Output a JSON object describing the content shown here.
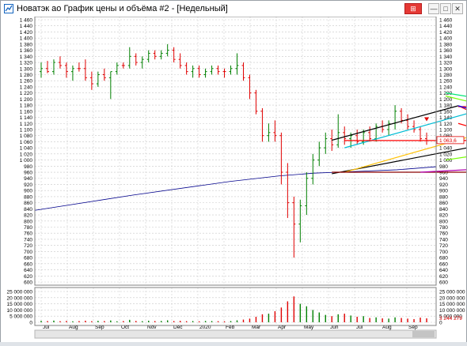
{
  "window": {
    "title": "Новатэк ао График цены и объёма #2 - [Недельный]",
    "buttons": {
      "pin": "⊞",
      "minimize": "—",
      "maximize": "□",
      "close": "✕"
    }
  },
  "chart_data": {
    "type": "ohlc-bar",
    "title": "",
    "price_axis": {
      "ylim": [
        600,
        1460
      ],
      "ticks": [
        "1 460",
        "1 440",
        "1 420",
        "1 400",
        "1 380",
        "1 360",
        "1 340",
        "1 320",
        "1 300",
        "1 280",
        "1 260",
        "1 240",
        "1 220",
        "1 200",
        "1 180",
        "1 160",
        "1 140",
        "1 120",
        "1 100",
        "1 080",
        "1 060",
        "1 040",
        "1 020",
        "1 000",
        "980",
        "960",
        "940",
        "920",
        "900",
        "880",
        "860",
        "840",
        "820",
        "800",
        "780",
        "760",
        "740",
        "720",
        "700",
        "680",
        "660",
        "640",
        "620",
        "600"
      ]
    },
    "volume_axis": {
      "ylim": [
        0,
        25000000
      ],
      "ticks": [
        "25 000 000",
        "20 000 000",
        "15 000 000",
        "10 000 000",
        "5 000 000",
        "0"
      ]
    },
    "x_axis": {
      "labels": [
        "Jul",
        "Aug",
        "Sep",
        "Oct",
        "Nov",
        "Dec",
        "2020",
        "Feb",
        "Mar",
        "Apr",
        "May",
        "Jun",
        "Jul",
        "Aug",
        "Sep"
      ]
    },
    "last_price_label": "1 063,6",
    "last_volume_label": "3 244 279",
    "bars": [
      {
        "o": 1290,
        "h": 1320,
        "l": 1270,
        "c": 1300,
        "up": true
      },
      {
        "o": 1300,
        "h": 1325,
        "l": 1285,
        "c": 1290,
        "up": false
      },
      {
        "o": 1290,
        "h": 1330,
        "l": 1280,
        "c": 1320,
        "up": true
      },
      {
        "o": 1320,
        "h": 1340,
        "l": 1300,
        "c": 1310,
        "up": false
      },
      {
        "o": 1310,
        "h": 1320,
        "l": 1270,
        "c": 1290,
        "up": false
      },
      {
        "o": 1290,
        "h": 1310,
        "l": 1260,
        "c": 1300,
        "up": true
      },
      {
        "o": 1300,
        "h": 1320,
        "l": 1290,
        "c": 1300,
        "up": false
      },
      {
        "o": 1300,
        "h": 1330,
        "l": 1260,
        "c": 1270,
        "up": false
      },
      {
        "o": 1270,
        "h": 1290,
        "l": 1230,
        "c": 1250,
        "up": false
      },
      {
        "o": 1250,
        "h": 1290,
        "l": 1240,
        "c": 1280,
        "up": true
      },
      {
        "o": 1280,
        "h": 1300,
        "l": 1260,
        "c": 1270,
        "up": false
      },
      {
        "o": 1270,
        "h": 1290,
        "l": 1200,
        "c": 1290,
        "up": true
      },
      {
        "o": 1290,
        "h": 1320,
        "l": 1280,
        "c": 1310,
        "up": true
      },
      {
        "o": 1310,
        "h": 1320,
        "l": 1300,
        "c": 1310,
        "up": false
      },
      {
        "o": 1310,
        "h": 1370,
        "l": 1300,
        "c": 1340,
        "up": true
      },
      {
        "o": 1340,
        "h": 1350,
        "l": 1310,
        "c": 1320,
        "up": false
      },
      {
        "o": 1320,
        "h": 1340,
        "l": 1300,
        "c": 1330,
        "up": true
      },
      {
        "o": 1330,
        "h": 1360,
        "l": 1320,
        "c": 1350,
        "up": true
      },
      {
        "o": 1350,
        "h": 1360,
        "l": 1330,
        "c": 1340,
        "up": false
      },
      {
        "o": 1340,
        "h": 1360,
        "l": 1330,
        "c": 1350,
        "up": true
      },
      {
        "o": 1350,
        "h": 1380,
        "l": 1340,
        "c": 1360,
        "up": true
      },
      {
        "o": 1360,
        "h": 1370,
        "l": 1320,
        "c": 1330,
        "up": false
      },
      {
        "o": 1330,
        "h": 1350,
        "l": 1300,
        "c": 1310,
        "up": false
      },
      {
        "o": 1310,
        "h": 1320,
        "l": 1280,
        "c": 1290,
        "up": false
      },
      {
        "o": 1290,
        "h": 1310,
        "l": 1270,
        "c": 1300,
        "up": true
      },
      {
        "o": 1300,
        "h": 1310,
        "l": 1270,
        "c": 1280,
        "up": false
      },
      {
        "o": 1280,
        "h": 1300,
        "l": 1270,
        "c": 1290,
        "up": true
      },
      {
        "o": 1290,
        "h": 1310,
        "l": 1280,
        "c": 1300,
        "up": true
      },
      {
        "o": 1300,
        "h": 1310,
        "l": 1280,
        "c": 1290,
        "up": false
      },
      {
        "o": 1290,
        "h": 1300,
        "l": 1270,
        "c": 1290,
        "up": false
      },
      {
        "o": 1290,
        "h": 1310,
        "l": 1280,
        "c": 1300,
        "up": true
      },
      {
        "o": 1300,
        "h": 1350,
        "l": 1280,
        "c": 1310,
        "up": true
      },
      {
        "o": 1310,
        "h": 1320,
        "l": 1260,
        "c": 1270,
        "up": false
      },
      {
        "o": 1270,
        "h": 1280,
        "l": 1200,
        "c": 1220,
        "up": false
      },
      {
        "o": 1220,
        "h": 1230,
        "l": 1150,
        "c": 1160,
        "up": false
      },
      {
        "o": 1160,
        "h": 1170,
        "l": 1060,
        "c": 1080,
        "up": false
      },
      {
        "o": 1080,
        "h": 1120,
        "l": 1060,
        "c": 1090,
        "up": true
      },
      {
        "o": 1090,
        "h": 1130,
        "l": 1060,
        "c": 1080,
        "up": false
      },
      {
        "o": 1080,
        "h": 1090,
        "l": 920,
        "c": 960,
        "up": false
      },
      {
        "o": 960,
        "h": 990,
        "l": 810,
        "c": 860,
        "up": false
      },
      {
        "o": 860,
        "h": 880,
        "l": 680,
        "c": 790,
        "up": false
      },
      {
        "o": 790,
        "h": 870,
        "l": 730,
        "c": 850,
        "up": true
      },
      {
        "o": 850,
        "h": 960,
        "l": 820,
        "c": 940,
        "up": true
      },
      {
        "o": 940,
        "h": 1020,
        "l": 920,
        "c": 1000,
        "up": true
      },
      {
        "o": 1000,
        "h": 1060,
        "l": 980,
        "c": 1040,
        "up": true
      },
      {
        "o": 1040,
        "h": 1090,
        "l": 1020,
        "c": 1070,
        "up": true
      },
      {
        "o": 1070,
        "h": 1100,
        "l": 1030,
        "c": 1050,
        "up": false
      },
      {
        "o": 1050,
        "h": 1150,
        "l": 1040,
        "c": 1090,
        "up": true
      },
      {
        "o": 1090,
        "h": 1110,
        "l": 1050,
        "c": 1070,
        "up": false
      },
      {
        "o": 1070,
        "h": 1090,
        "l": 1040,
        "c": 1080,
        "up": true
      },
      {
        "o": 1080,
        "h": 1100,
        "l": 1050,
        "c": 1060,
        "up": false
      },
      {
        "o": 1060,
        "h": 1100,
        "l": 1050,
        "c": 1090,
        "up": true
      },
      {
        "o": 1090,
        "h": 1110,
        "l": 1060,
        "c": 1070,
        "up": false
      },
      {
        "o": 1070,
        "h": 1120,
        "l": 1060,
        "c": 1110,
        "up": true
      },
      {
        "o": 1110,
        "h": 1130,
        "l": 1090,
        "c": 1100,
        "up": false
      },
      {
        "o": 1100,
        "h": 1130,
        "l": 1080,
        "c": 1120,
        "up": true
      },
      {
        "o": 1120,
        "h": 1180,
        "l": 1100,
        "c": 1160,
        "up": true
      },
      {
        "o": 1160,
        "h": 1170,
        "l": 1120,
        "c": 1130,
        "up": false
      },
      {
        "o": 1130,
        "h": 1150,
        "l": 1100,
        "c": 1110,
        "up": false
      },
      {
        "o": 1110,
        "h": 1130,
        "l": 1090,
        "c": 1100,
        "up": false
      },
      {
        "o": 1100,
        "h": 1110,
        "l": 1060,
        "c": 1070,
        "up": false
      },
      {
        "o": 1070,
        "h": 1090,
        "l": 1050,
        "c": 1064,
        "up": false
      }
    ],
    "volumes": [
      1.2,
      1.0,
      1.4,
      0.9,
      1.1,
      0.8,
      1.0,
      1.3,
      0.9,
      1.2,
      1.0,
      1.5,
      0.8,
      1.0,
      2.0,
      1.1,
      0.9,
      1.3,
      1.0,
      1.1,
      1.6,
      1.0,
      1.2,
      0.9,
      1.0,
      0.8,
      1.1,
      1.0,
      0.9,
      0.8,
      1.0,
      1.6,
      2.2,
      3.0,
      4.5,
      6.5,
      7.0,
      9.0,
      12.0,
      17.0,
      21.0,
      15.0,
      13.0,
      10.0,
      8.0,
      6.0,
      5.0,
      6.5,
      7.0,
      5.5,
      4.5,
      5.0,
      3.5,
      4.0,
      3.2,
      3.0,
      4.0,
      3.5,
      3.0,
      2.6,
      3.8,
      3.2
    ],
    "ma_line": [
      [
        0,
        835
      ],
      [
        20,
        885
      ],
      [
        40,
        930
      ],
      [
        50,
        948
      ],
      [
        57,
        957
      ],
      [
        62,
        960
      ],
      [
        74,
        968
      ],
      [
        82,
        978
      ]
    ],
    "drawings": [
      {
        "color": "#000000",
        "pts": [
          [
            46,
            1065
          ],
          [
            66,
            1178
          ]
        ]
      },
      {
        "color": "#000000",
        "pts": [
          [
            46,
            955
          ],
          [
            75,
            1070
          ]
        ]
      },
      {
        "color": "#00bcd4",
        "pts": [
          [
            48,
            1040
          ],
          [
            80,
            1225
          ]
        ]
      },
      {
        "color": "#ffc107",
        "pts": [
          [
            48,
            960
          ],
          [
            76,
            1125
          ]
        ]
      },
      {
        "color": "#ff0000",
        "pts": [
          [
            48,
            1064
          ],
          [
            78,
            1064
          ]
        ]
      },
      {
        "color": "#ff0000",
        "pts": [
          [
            66,
            1175
          ],
          [
            78,
            1175
          ]
        ]
      },
      {
        "color": "#ff0000",
        "pts": [
          [
            66,
            1120
          ],
          [
            76,
            1060
          ]
        ]
      },
      {
        "color": "#ff0000",
        "pts": [
          [
            66,
            1178
          ],
          [
            76,
            1080
          ]
        ]
      },
      {
        "color": "#0000ff",
        "pts": [
          [
            66,
            1178
          ],
          [
            79,
            1100
          ]
        ]
      },
      {
        "color": "#00e676",
        "pts": [
          [
            64,
            1220
          ],
          [
            73,
            1190
          ]
        ]
      },
      {
        "color": "#76ff03",
        "pts": [
          [
            64,
            1210
          ],
          [
            76,
            1150
          ]
        ]
      },
      {
        "color": "#76ff03",
        "pts": [
          [
            64,
            1000
          ],
          [
            72,
            1025
          ]
        ]
      },
      {
        "color": "#8b0000",
        "pts": [
          [
            46,
            960
          ],
          [
            78,
            960
          ]
        ]
      },
      {
        "color": "#b000b0",
        "pts": [
          [
            60,
            960
          ],
          [
            78,
            980
          ]
        ]
      }
    ],
    "grid": true
  }
}
